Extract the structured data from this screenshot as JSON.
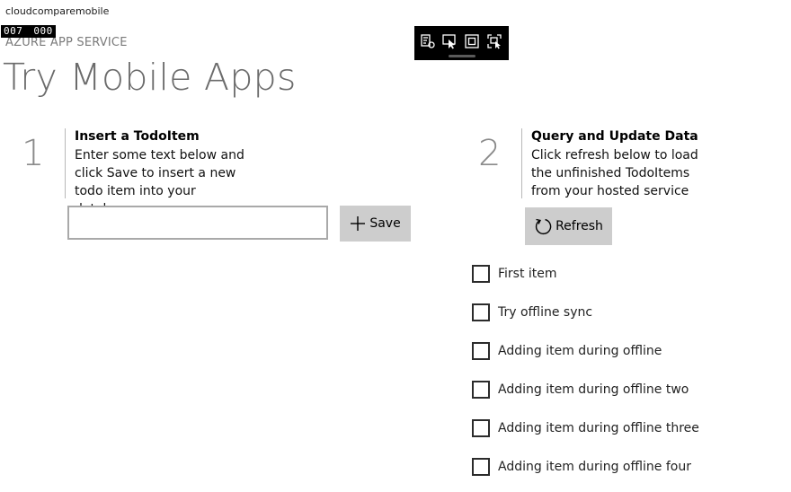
{
  "window": {
    "title": "cloudcomparemobile"
  },
  "frame_counter": {
    "left": "007",
    "right": "000"
  },
  "header": {
    "subtitle": "AZURE APP SERVICE",
    "title": "Try Mobile Apps"
  },
  "debug_toolbar": {
    "icons": [
      "select-element-icon",
      "pointer-icon",
      "layout-adorner-icon",
      "track-focus-icon"
    ]
  },
  "step1": {
    "number": "1",
    "heading": "Insert a TodoItem",
    "description": "Enter some text below and click Save to insert a new todo item into your database",
    "input": {
      "value": "",
      "placeholder": ""
    },
    "save_label": "Save"
  },
  "step2": {
    "number": "2",
    "heading": "Query and Update Data",
    "description": "Click refresh below to load the unfinished TodoItems from your hosted service",
    "refresh_label": "Refresh"
  },
  "todo_items": [
    {
      "label": "First item",
      "checked": false
    },
    {
      "label": "Try offline sync",
      "checked": false
    },
    {
      "label": "Adding item during offline",
      "checked": false
    },
    {
      "label": "Adding item during offline two",
      "checked": false
    },
    {
      "label": "Adding item during offline three",
      "checked": false
    },
    {
      "label": "Adding item during offline four",
      "checked": false
    }
  ],
  "colors": {
    "background": "#ffffff",
    "title_gray": "#6b6b6b",
    "button_gray": "#cdcdcd",
    "toolbar": "#000000"
  }
}
